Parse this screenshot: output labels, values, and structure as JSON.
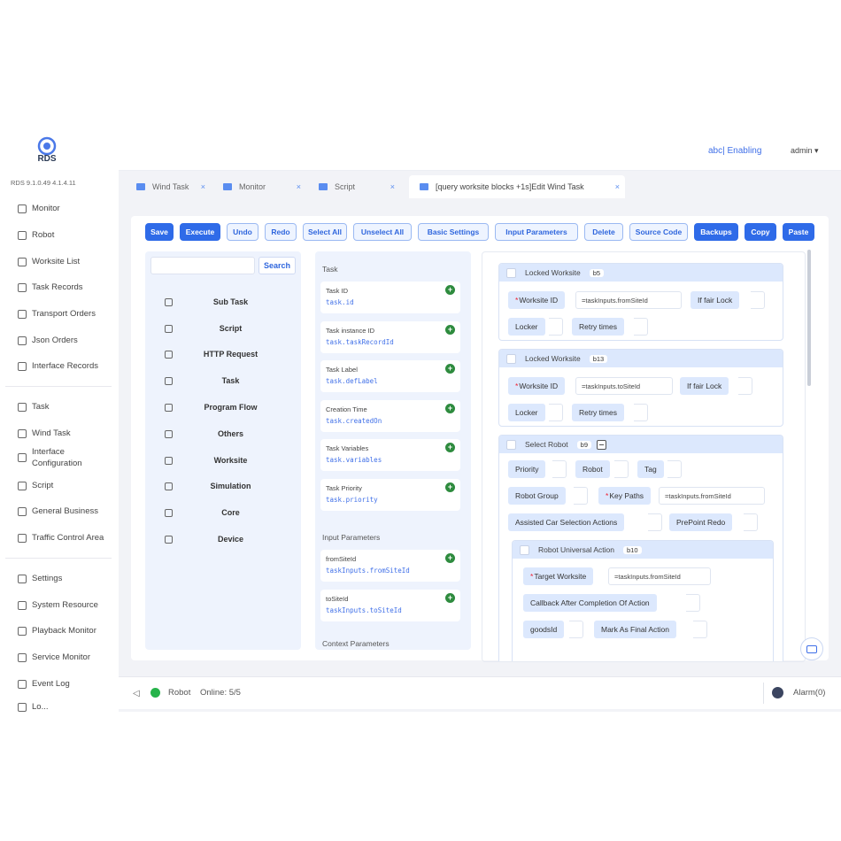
{
  "header": {
    "logo_text": "RDS",
    "status": "abc| Enabling",
    "user": "admin"
  },
  "sidebar": {
    "version": "RDS 9.1.0.49 4.1.4.11",
    "groups": [
      [
        "Monitor",
        "Robot",
        "Worksite List",
        "Task Records",
        "Transport Orders",
        "Json Orders",
        "Interface Records"
      ],
      [
        "Task",
        "Wind Task",
        "Interface Configuration",
        "Script",
        "General Business",
        "Traffic Control Area"
      ],
      [
        "Settings",
        "System Resource",
        "Playback Monitor",
        "Service Monitor",
        "Event Log",
        "Lo..."
      ]
    ]
  },
  "tabs": [
    "Wind Task",
    "Monitor",
    "Script",
    "[query worksite blocks +1s]Edit Wind Task"
  ],
  "toolbar": [
    "Save",
    "Execute",
    "Undo",
    "Redo",
    "Select All",
    "Unselect All",
    "Basic Settings",
    "Input Parameters",
    "Delete",
    "Source Code",
    "Backups",
    "Copy",
    "Paste"
  ],
  "search": {
    "button": "Search",
    "placeholder": ""
  },
  "categories": [
    "Sub Task",
    "Script",
    "HTTP Request",
    "Task",
    "Program Flow",
    "Others",
    "Worksite",
    "Simulation",
    "Core",
    "Device"
  ],
  "variables": {
    "task_title": "Task",
    "task_vars": [
      {
        "name": "Task ID",
        "code": "task.id"
      },
      {
        "name": "Task instance ID",
        "code": "task.taskRecordId"
      },
      {
        "name": "Task Label",
        "code": "task.defLabel"
      },
      {
        "name": "Creation Time",
        "code": "task.createdOn"
      },
      {
        "name": "Task Variables",
        "code": "task.variables"
      },
      {
        "name": "Task Priority",
        "code": "task.priority"
      }
    ],
    "input_title": "Input Parameters",
    "input_vars": [
      {
        "name": "fromSiteId",
        "code": "taskInputs.fromSiteId"
      },
      {
        "name": "toSiteId",
        "code": "taskInputs.toSiteId"
      }
    ],
    "context_title": "Context Parameters"
  },
  "blocks": {
    "b1": {
      "title": "Locked Worksite",
      "badge": "b5",
      "site_label": "Worksite ID",
      "site_value": "=taskInputs.fromSiteId",
      "lock_label": "If fair Lock",
      "locker": "Locker",
      "retry": "Retry times"
    },
    "b2": {
      "title": "Locked Worksite",
      "badge": "b13",
      "site_label": "Worksite ID",
      "site_value": "=taskInputs.toSiteId",
      "lock_label": "If fair Lock",
      "locker": "Locker",
      "retry": "Retry times"
    },
    "b3": {
      "title": "Select Robot",
      "badge": "b9",
      "priority": "Priority",
      "robot": "Robot",
      "tag": "Tag",
      "robot_group": "Robot Group",
      "key_paths": "Key Paths",
      "key_paths_value": "=taskInputs.fromSiteId",
      "assisted": "Assisted Car Selection Actions",
      "prepoint": "PrePoint Redo"
    },
    "b4": {
      "title": "Robot Universal Action",
      "badge": "b10",
      "target_label": "Target Worksite",
      "target_value": "=taskInputs.fromSiteId",
      "callback": "Callback After Completion Of Action",
      "goodsid": "goodsId",
      "mark_final": "Mark As Final Action"
    }
  },
  "statusbar": {
    "robot_label": "Robot",
    "online": "Online: 5/5",
    "alarm": "Alarm(0)"
  }
}
